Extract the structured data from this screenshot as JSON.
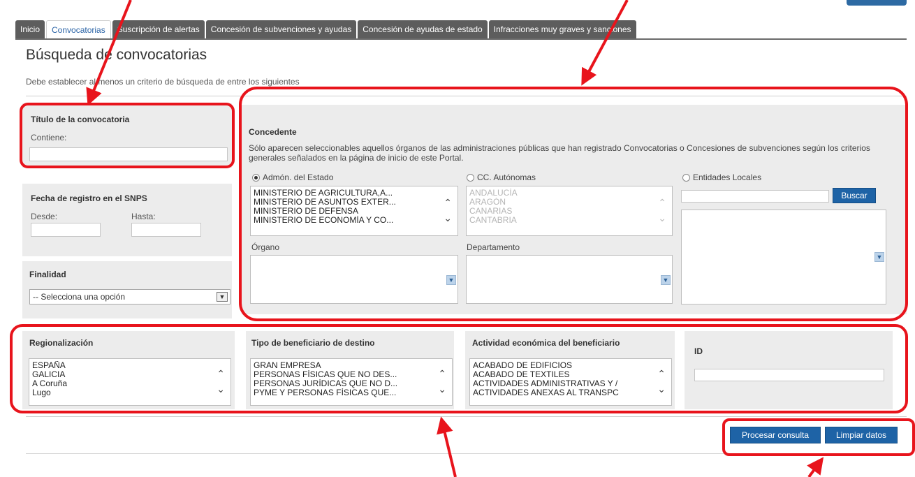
{
  "tabs": [
    {
      "label": "Inicio",
      "active": false
    },
    {
      "label": "Convocatorias",
      "active": true
    },
    {
      "label": "Suscripción de alertas",
      "active": false
    },
    {
      "label": "Concesión de subvenciones y ayudas",
      "active": false
    },
    {
      "label": "Concesión de ayudas de estado",
      "active": false
    },
    {
      "label": "Infracciones muy graves y sanciones",
      "active": false
    }
  ],
  "page": {
    "title": "Búsqueda de convocatorias",
    "intro": "Debe establecer al menos un criterio de búsqueda de entre los siguientes"
  },
  "titulo": {
    "heading": "Título de la convocatoria",
    "label": "Contiene:",
    "value": ""
  },
  "fecha": {
    "heading": "Fecha de registro en el SNPS",
    "desde_label": "Desde:",
    "hasta_label": "Hasta:",
    "desde_value": "",
    "hasta_value": ""
  },
  "finalidad": {
    "heading": "Finalidad",
    "selected": "-- Selecciona una opción"
  },
  "concedente": {
    "heading": "Concedente",
    "description": "Sólo aparecen seleccionables aquellos órganos de las administraciones públicas que han registrado Convocatorias o Concesiones de subvenciones según los criterios generales señalados en la página de inicio de este Portal.",
    "radios": {
      "estado": "Admón. del Estado",
      "autonomas": "CC. Autónomas",
      "locales": "Entidades Locales"
    },
    "selected_radio": "estado",
    "estado_items": [
      "MINISTERIO DE AGRICULTURA,A...",
      "MINISTERIO DE ASUNTOS EXTER...",
      "MINISTERIO DE DEFENSA",
      "MINISTERIO DE ECONOMÍA Y CO..."
    ],
    "autonomas_items": [
      "ANDALUCÍA",
      "ARAGÓN",
      "CANARIAS",
      "CANTABRIA"
    ],
    "organo_label": "Órgano",
    "departamento_label": "Departamento",
    "buscar_label": "Buscar",
    "locales_search_value": ""
  },
  "regionalizacion": {
    "heading": "Regionalización",
    "items": [
      "ESPAÑA",
      "GALICIA",
      "A Coruña",
      "Lugo"
    ]
  },
  "beneficiario": {
    "heading": "Tipo de beneficiario de destino",
    "items": [
      "GRAN EMPRESA",
      "PERSONAS FÍSICAS QUE NO DES...",
      "PERSONAS JURÍDICAS QUE NO D...",
      "PYME Y PERSONAS FÍSICAS QUE..."
    ]
  },
  "actividad": {
    "heading": "Actividad económica del beneficiario",
    "items": [
      "ACABADO DE EDIFICIOS",
      "ACABADO DE TEXTILES",
      "ACTIVIDADES ADMINISTRATIVAS Y /",
      "ACTIVIDADES ANEXAS AL TRANSPC"
    ]
  },
  "id_field": {
    "heading": "ID",
    "value": ""
  },
  "actions": {
    "procesar": "Procesar consulta",
    "limpiar": "Limpiar datos"
  },
  "icons": {
    "scroll_up": "chevron-up-icon",
    "scroll_down": "chevron-down-icon",
    "dropdown": "dropdown-arrow-icon"
  },
  "colors": {
    "tab_inactive": "#5d5d5d",
    "tab_active_text": "#2a63a6",
    "button_blue": "#1e63a6",
    "annotation_red": "#e8141c",
    "panel_bg": "#ececec"
  }
}
